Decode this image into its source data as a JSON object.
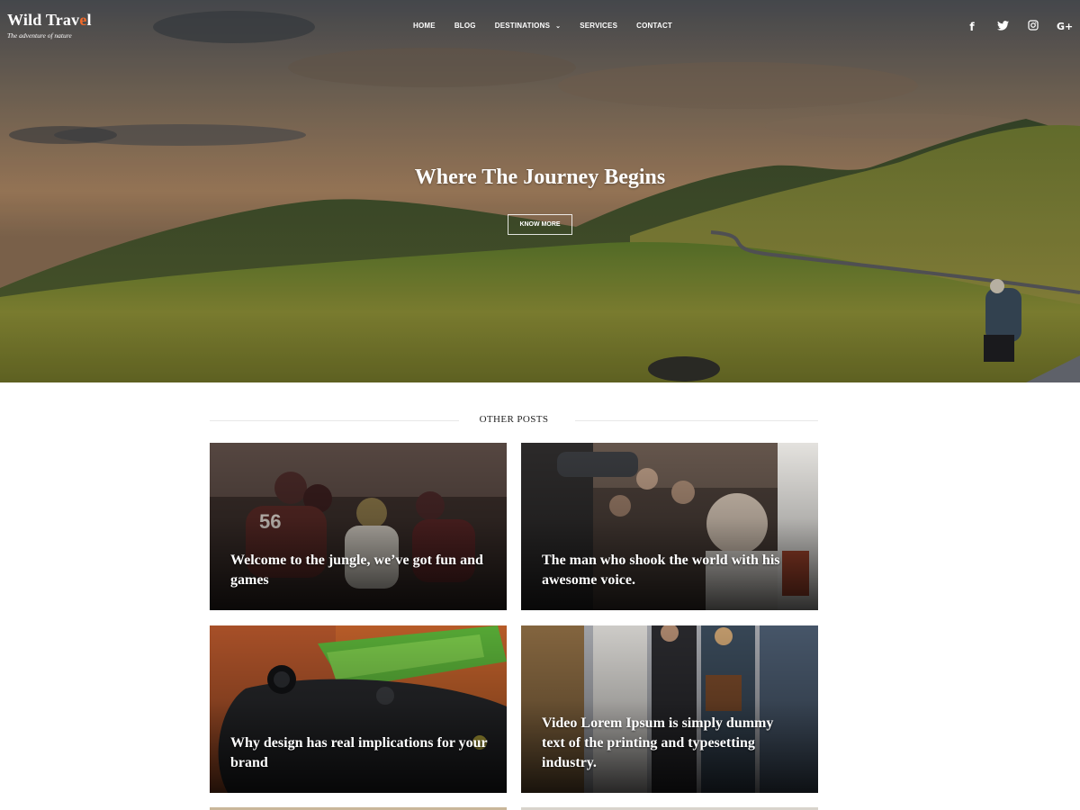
{
  "brand": {
    "title_main": "Wild Trav",
    "title_accent": "e",
    "title_end": "l",
    "tagline": "The adventure of nature",
    "accent_color": "#f26b2a"
  },
  "nav": {
    "items": [
      {
        "label": "HOME"
      },
      {
        "label": "BLOG"
      },
      {
        "label": "DESTINATIONS",
        "has_dropdown": true
      },
      {
        "label": "SERVICES"
      },
      {
        "label": "CONTACT"
      }
    ]
  },
  "social": [
    {
      "icon": "facebook-icon",
      "glyph": "f"
    },
    {
      "icon": "twitter-icon",
      "glyph": "🐦"
    },
    {
      "icon": "instagram-icon",
      "glyph": "◎"
    },
    {
      "icon": "google-plus-icon",
      "glyph": "G+"
    }
  ],
  "hero": {
    "title": "Where The Journey Begins",
    "button_label": "KNOW MORE"
  },
  "section": {
    "title": "OTHER POSTS"
  },
  "posts": [
    {
      "title": "Welcome to the jungle, we’ve got fun and games"
    },
    {
      "title": "The man who shook the world with his awesome voice."
    },
    {
      "title": "Why design has real implications for your brand"
    },
    {
      "title": "Video Lorem Ipsum is simply dummy text of the printing and typesetting industry."
    }
  ]
}
